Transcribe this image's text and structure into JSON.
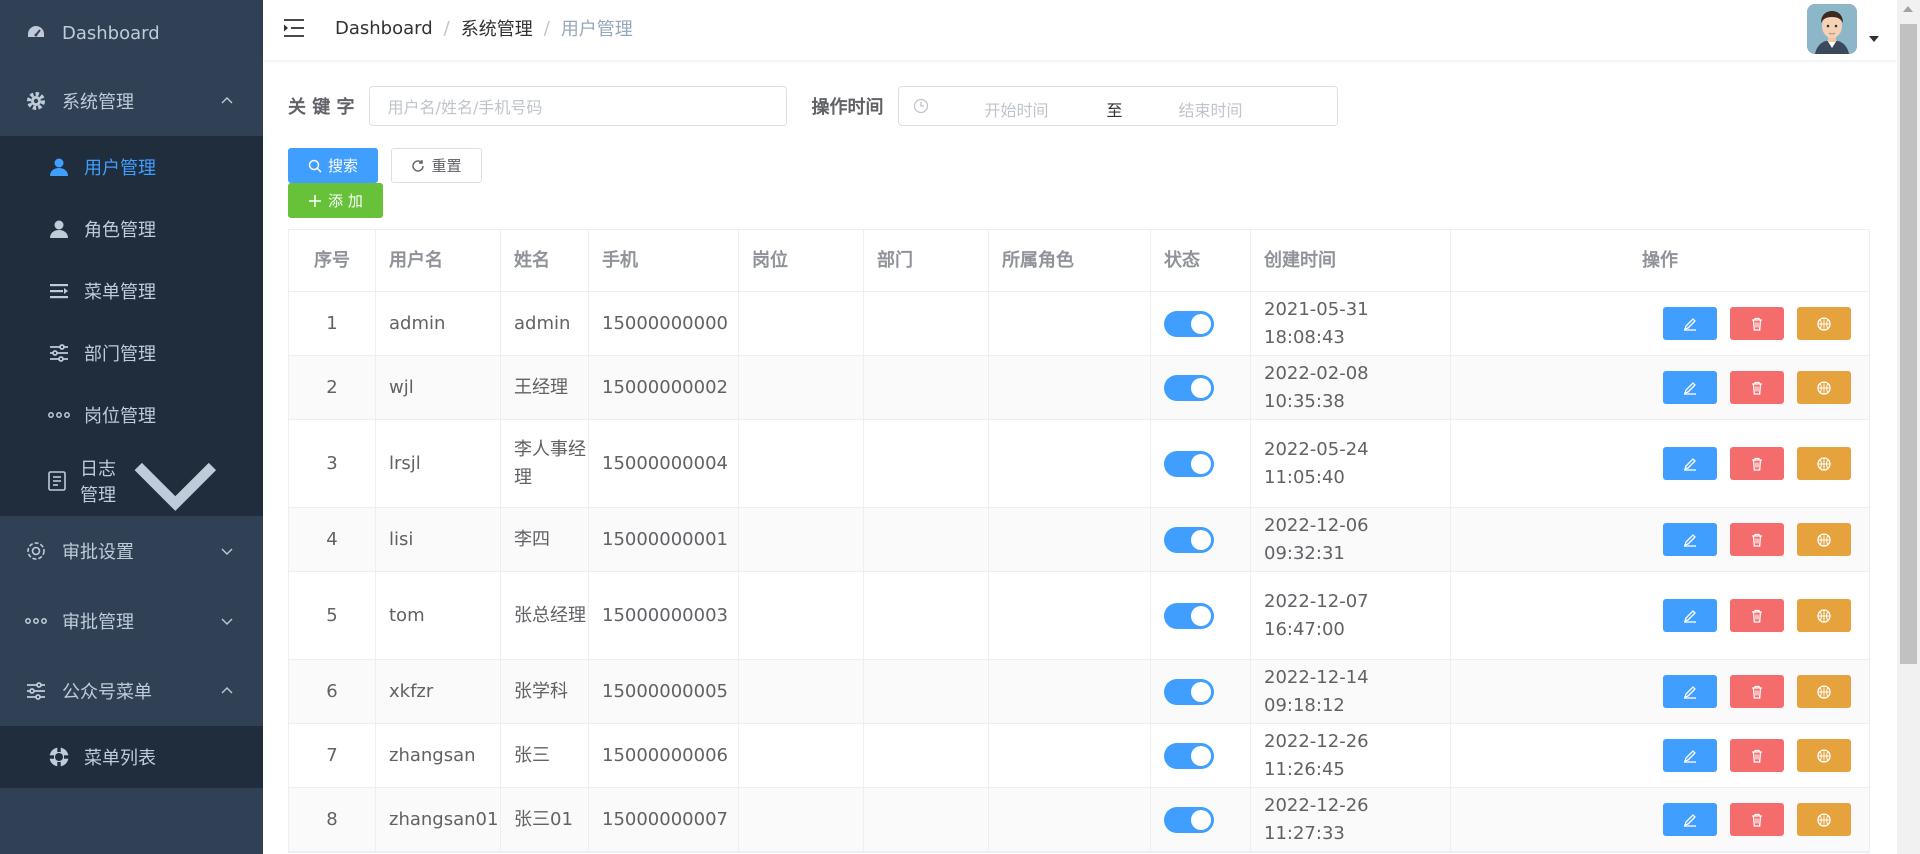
{
  "sidebar": {
    "dashboard": "Dashboard",
    "system": "系统管理",
    "system_items": [
      "用户管理",
      "角色管理",
      "菜单管理",
      "部门管理",
      "岗位管理",
      "日志管理"
    ],
    "approval_settings": "审批设置",
    "approval_manage": "审批管理",
    "official_menu": "公众号菜单",
    "official_items": [
      "菜单列表"
    ]
  },
  "breadcrumb": {
    "items": [
      "Dashboard",
      "系统管理",
      "用户管理"
    ],
    "separator": "/"
  },
  "filter": {
    "keyword_label": "关 键 字",
    "keyword_placeholder": "用户名/姓名/手机号码",
    "time_label": "操作时间",
    "start_placeholder": "开始时间",
    "range_sep": "至",
    "end_placeholder": "结束时间"
  },
  "buttons": {
    "search": "搜索",
    "reset": "重置",
    "add": "添 加"
  },
  "table": {
    "headers": [
      "序号",
      "用户名",
      "姓名",
      "手机",
      "岗位",
      "部门",
      "所属角色",
      "状态",
      "创建时间",
      "操作"
    ],
    "rows": [
      {
        "idx": "1",
        "username": "admin",
        "name": "admin",
        "phone": "15000000000",
        "post": "",
        "dept": "",
        "role": "",
        "created": "2021-05-31 18:08:43"
      },
      {
        "idx": "2",
        "username": "wjl",
        "name": "王经理",
        "phone": "15000000002",
        "post": "",
        "dept": "",
        "role": "",
        "created": "2022-02-08 10:35:38"
      },
      {
        "idx": "3",
        "username": "lrsjl",
        "name": "李人事经理",
        "phone": "15000000004",
        "post": "",
        "dept": "",
        "role": "",
        "created": "2022-05-24 11:05:40"
      },
      {
        "idx": "4",
        "username": "lisi",
        "name": "李四",
        "phone": "15000000001",
        "post": "",
        "dept": "",
        "role": "",
        "created": "2022-12-06 09:32:31"
      },
      {
        "idx": "5",
        "username": "tom",
        "name": "张总经理",
        "phone": "15000000003",
        "post": "",
        "dept": "",
        "role": "",
        "created": "2022-12-07 16:47:00"
      },
      {
        "idx": "6",
        "username": "xkfzr",
        "name": "张学科",
        "phone": "15000000005",
        "post": "",
        "dept": "",
        "role": "",
        "created": "2022-12-14 09:18:12"
      },
      {
        "idx": "7",
        "username": "zhangsan",
        "name": "张三",
        "phone": "15000000006",
        "post": "",
        "dept": "",
        "role": "",
        "created": "2022-12-26 11:26:45"
      },
      {
        "idx": "8",
        "username": "zhangsan01",
        "name": "张三01",
        "phone": "15000000007",
        "post": "",
        "dept": "",
        "role": "",
        "created": "2022-12-26 11:27:33"
      }
    ]
  },
  "colors": {
    "sidebar_bg": "#304156",
    "submenu_bg": "#1f2d3d",
    "primary": "#409eff",
    "danger": "#f56c6c",
    "warning": "#e6a23c",
    "success": "#67c23a"
  },
  "icons": {
    "dashboard": "dashboard-icon",
    "system": "gear-icon",
    "user": "user-icon",
    "role": "user-icon",
    "menu": "menu-list-icon",
    "dept": "sliders-icon",
    "post": "more-icon",
    "log": "document-icon",
    "approval_settings": "setting-icon",
    "approval_manage": "more-icon",
    "official": "sliders-icon",
    "menu_list": "help-icon",
    "edit": "edit-icon",
    "delete": "delete-icon",
    "role_assign": "basketball-icon"
  }
}
